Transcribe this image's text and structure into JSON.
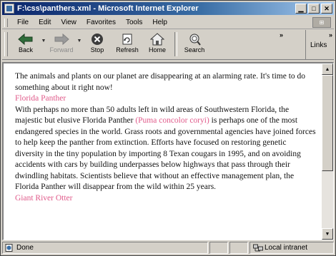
{
  "window": {
    "title": "F:\\css\\panthers.xml - Microsoft Internet Explorer",
    "buttons": [
      "minimize",
      "maximize",
      "close"
    ]
  },
  "menubar": {
    "items": [
      "File",
      "Edit",
      "View",
      "Favorites",
      "Tools",
      "Help"
    ]
  },
  "toolbar": {
    "back": "Back",
    "forward": "Forward",
    "stop": "Stop",
    "refresh": "Refresh",
    "home": "Home",
    "search": "Search",
    "links": "Links"
  },
  "content": {
    "intro": "The animals and plants on our planet are disappearing at an alarming rate. It's time to do something about it right now!",
    "heading1": "Florida Panther",
    "para1_start": "With perhaps no more than 50 adults left in wild areas of Southwestern Florida, the majestic but elusive Florida Panther ",
    "para1_latin": "(Puma concolor coryi)",
    "para1_end": " is perhaps one of the most endangered species in the world. Grass roots and governmental agencies have joined forces to help keep the panther from extinction. Efforts have focused on restoring genetic diversity in the tiny population by importing 8 Texan cougars in 1995, and on avoiding accidents with cars by building underpasses below highways that pass through their dwindling habitats. Scientists believe that without an effective management plan, the Florida Panther will disappear from the wild within 25 years.",
    "heading2": "Giant River Otter"
  },
  "statusbar": {
    "status": "Done",
    "zone": "Local intranet"
  },
  "colors": {
    "accent_link": "#e05a8a",
    "titlebar": "#0a246a"
  },
  "icons": [
    "back-arrow-icon",
    "forward-arrow-icon",
    "stop-icon",
    "refresh-icon",
    "home-icon",
    "search-icon",
    "page-icon",
    "intranet-icon"
  ]
}
